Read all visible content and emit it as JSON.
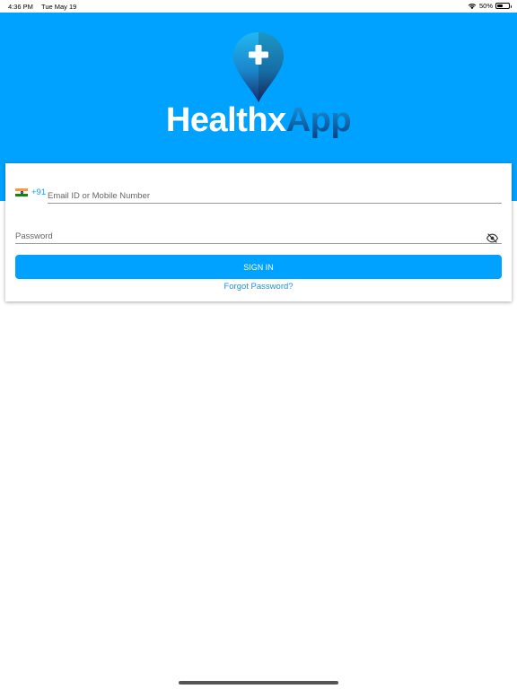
{
  "status_bar": {
    "time": "4:36 PM",
    "date": "Tue May 19",
    "battery_text": "50%",
    "battery_level": 0.5,
    "wifi_icon": "wifi-icon",
    "battery_icon": "battery-icon"
  },
  "header": {
    "logo_icon": "location-pin-plus-icon",
    "logo_text_part1": "Healthx",
    "logo_text_part2": "App"
  },
  "login_form": {
    "country_flag": "india-flag-icon",
    "country_code": "+91",
    "email_placeholder": "Email ID or Mobile Number",
    "email_value": "",
    "password_placeholder": "Password",
    "password_value": "",
    "password_toggle_icon": "eye-slash-icon",
    "signin_label": "SIGN IN",
    "forgot_password_label": "Forgot Password?"
  },
  "colors": {
    "primary": "#00a2ff",
    "header_bg": "#00a2ff",
    "link": "#1c8fe0",
    "logo_app_dark": "#0b3f7f"
  }
}
